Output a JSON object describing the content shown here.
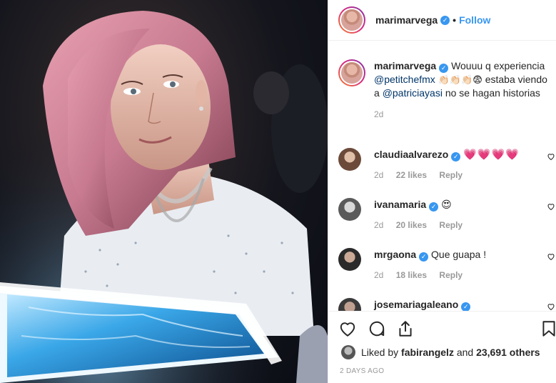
{
  "post": {
    "author": "marimarvega",
    "follow_label": "Follow",
    "separator": "•"
  },
  "caption": {
    "author": "marimarvega",
    "text_1": "Wouuu q experiencia",
    "mention_1": "@petitchefmx",
    "text_2": "estaba viendo a",
    "mention_2": "@patriciayasi",
    "text_3": "no se hagan historias",
    "time": "2d",
    "emojis": "👏🏻👏🏻👏🏻😨"
  },
  "comments": [
    {
      "user": "claudiaalvarezo",
      "text": "💗💗💗💗",
      "time": "2d",
      "likes": "22 likes",
      "reply": "Reply",
      "verified": true
    },
    {
      "user": "ivanamaria",
      "text": "😍",
      "time": "2d",
      "likes": "20 likes",
      "reply": "Reply",
      "verified": true
    },
    {
      "user": "mrgaona",
      "text": "Que guapa !",
      "time": "2d",
      "likes": "18 likes",
      "reply": "Reply",
      "verified": true
    },
    {
      "user": "josemariagaleano",
      "text": "",
      "time": "",
      "likes": "",
      "reply": "",
      "verified": true
    }
  ],
  "likes_line": {
    "prefix": "Liked by",
    "user": "fabirangelz",
    "mid": "and",
    "count": "23,691 others"
  },
  "posted_ago": "2 DAYS AGO",
  "icons": {
    "like": "heart-outline-icon",
    "comment": "speech-bubble-icon",
    "share": "share-upload-icon",
    "save": "bookmark-icon",
    "verified": "verified-badge-icon"
  },
  "colors": {
    "link_blue": "#3897f0",
    "mention": "#003569",
    "muted": "#999999",
    "text": "#262626"
  }
}
